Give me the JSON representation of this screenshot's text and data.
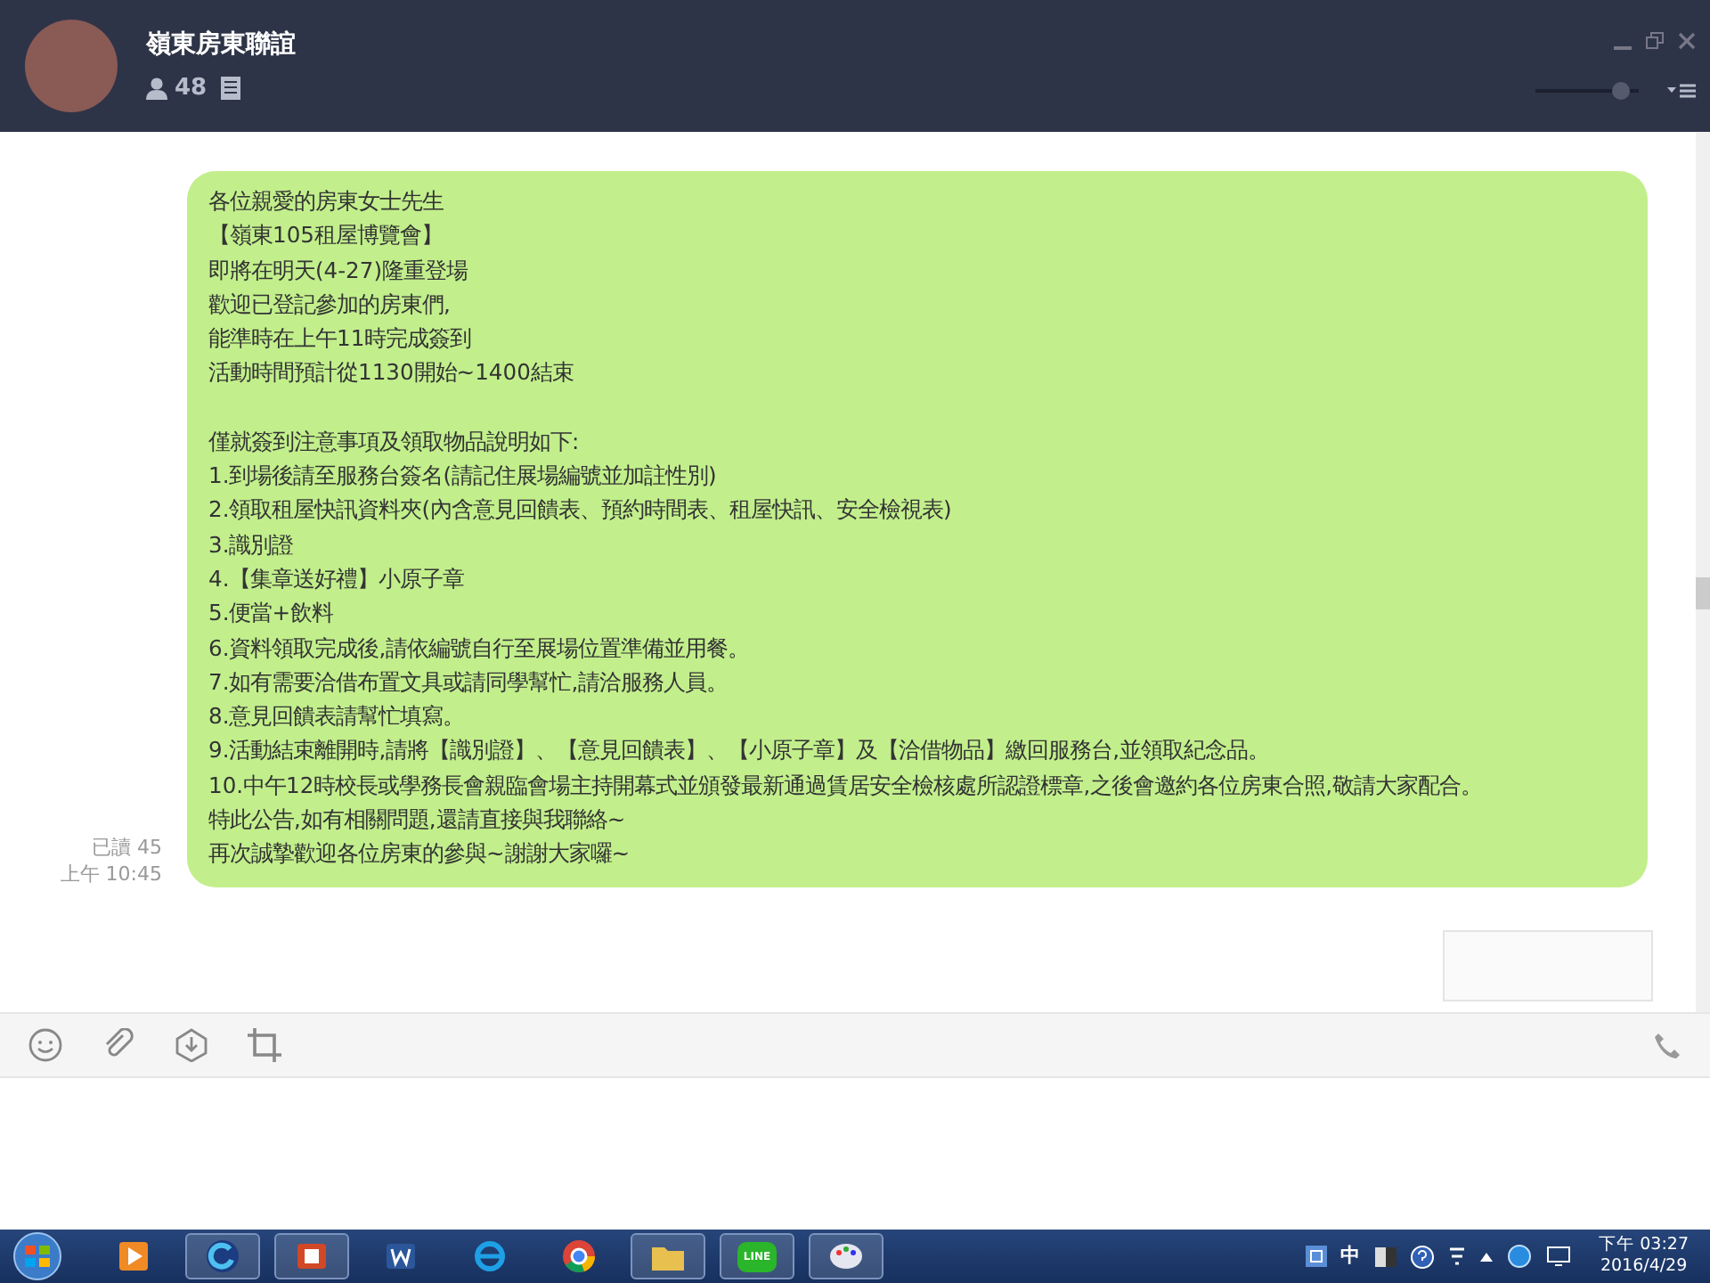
{
  "header": {
    "title": "嶺東房東聯誼",
    "member_count": "48",
    "volume": {
      "level": 0.9
    }
  },
  "message": {
    "paragraphs": [
      [
        "各位親愛的房東女士先生",
        "【嶺東105租屋博覽會】",
        "即將在明天(4-27)隆重登場",
        "歡迎已登記參加的房東們,",
        "能準時在上午11時完成簽到",
        "活動時間預計從1130開始~1400結束"
      ],
      [
        "僅就簽到注意事項及領取物品說明如下:",
        "1.到場後請至服務台簽名(請記住展場編號並加註性別)",
        "2.領取租屋快訊資料夾(內含意見回饋表、預約時間表、租屋快訊、安全檢視表)",
        "3.識別證",
        "4.【集章送好禮】小原子章",
        "5.便當+飲料",
        "6.資料領取完成後,請依編號自行至展場位置準備並用餐。",
        "7.如有需要洽借布置文具或請同學幫忙,請洽服務人員。",
        "8.意見回饋表請幫忙填寫。",
        "9.活動結束離開時,請將【識別證】、【意見回饋表】、【小原子章】及【洽借物品】繳回服務台,並領取紀念品。",
        "10.中午12時校長或學務長會親臨會場主持開幕式並頒發最新通過賃居安全檢核處所認證標章,之後會邀約各位房東合照,敬請大家配合。",
        "特此公告,如有相關問題,還請直接與我聯絡~",
        "再次誠摯歡迎各位房東的參與~謝謝大家囉~"
      ]
    ],
    "read_receipt": "已讀 45",
    "time": "上午 10:45"
  },
  "taskbar": {
    "apps": [
      {
        "kind": "media",
        "running": false
      },
      {
        "kind": "sync",
        "running": true
      },
      {
        "kind": "slides",
        "running": true
      },
      {
        "kind": "word",
        "running": false
      },
      {
        "kind": "browser-e",
        "running": false
      },
      {
        "kind": "chrome",
        "running": false
      },
      {
        "kind": "folder",
        "running": true
      },
      {
        "kind": "chat",
        "running": true,
        "label": "LINE"
      },
      {
        "kind": "paint",
        "running": true
      }
    ],
    "ime": "中",
    "clock_time": "下午 03:27",
    "clock_date": "2016/4/29"
  }
}
